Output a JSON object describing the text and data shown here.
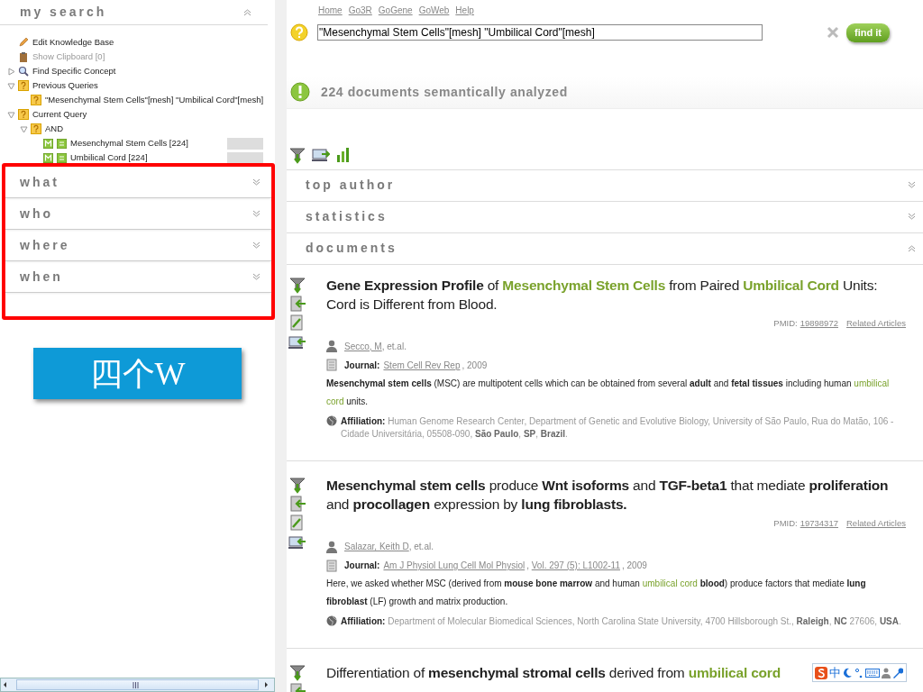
{
  "sidebar": {
    "title": "my search",
    "expanded": true,
    "tree": [
      {
        "kind": "edit",
        "label": "Edit Knowledge Base",
        "disabled": false
      },
      {
        "kind": "clipboard",
        "label": "Show Clipboard [0]",
        "disabled": true
      },
      {
        "kind": "search",
        "label": "Find Specific Concept",
        "disabled": false,
        "expanded": false
      },
      {
        "kind": "query",
        "label": "Previous Queries",
        "disabled": false,
        "expanded": true,
        "children": [
          {
            "kind": "query",
            "label": "\"Mesenchymal Stem Cells\"[mesh] \"Umbilical Cord\"[mesh]",
            "disabled": false
          }
        ]
      },
      {
        "kind": "query",
        "label": "Current Query",
        "disabled": false,
        "expanded": true,
        "children": [
          {
            "kind": "query",
            "label": "AND",
            "disabled": false,
            "expanded": true,
            "children": [
              {
                "kind": "concept",
                "label": "Mesenchymal Stem Cells [224]",
                "disabled": false
              },
              {
                "kind": "concept",
                "label": "Umbilical Cord [224]",
                "disabled": false
              }
            ]
          }
        ]
      }
    ],
    "sections_highlighted": true,
    "sections": [
      {
        "label": "what",
        "expanded": false
      },
      {
        "label": "who",
        "expanded": false
      },
      {
        "label": "where",
        "expanded": false
      },
      {
        "label": "when",
        "expanded": false
      }
    ],
    "callout": "四个W"
  },
  "nav": [
    "Home",
    "Go3R",
    "GoGene",
    "GoWeb",
    "Help"
  ],
  "query": {
    "value": "\"Mesenchymal Stem Cells\"[mesh] \"Umbilical Cord\"[mesh]"
  },
  "find_button": "find it",
  "status": "224 documents semantically analyzed",
  "panels": [
    {
      "label": "top author",
      "expanded": false
    },
    {
      "label": "statistics",
      "expanded": false
    },
    {
      "label": "documents",
      "expanded": true
    }
  ],
  "documents": [
    {
      "title": "**Gene Expression Profile** of *Mesenchymal Stem Cells* from Paired *Umbilical Cord* Units: Cord is Different from Blood.",
      "pmid_label": "PMID:",
      "pmid": "19898972",
      "related": "Related Articles",
      "author": "Secco, M",
      "author_suffix": ", et.al.",
      "journal_label": "Journal:",
      "journal": [
        {
          "kind": "link",
          "text": "Stem Cell Rev Rep"
        },
        {
          "kind": "text",
          "text": ", 2009"
        }
      ],
      "abstract": "**Mesenchymal stem cells** (MSC) are multipotent cells which can be obtained from several **adult** and **fetal tissues** including human *umbilical cord* units.",
      "affiliation_label": "Affiliation:",
      "affiliation": "Human Genome Research Center, Department of Genetic and Evolutive Biology, University of São Paulo, Rua do Matão, 106 - Cidade Universitária, 05508-090, **São Paulo**, **SP**, **Brazil**."
    },
    {
      "title": "**Mesenchymal stem cells** produce **Wnt isoforms** and **TGF-beta1** that mediate **proliferation** and **procollagen** expression by **lung fibroblasts.**",
      "pmid_label": "PMID:",
      "pmid": "19734317",
      "related": "Related Articles",
      "author": "Salazar, Keith D",
      "author_suffix": ", et.al.",
      "journal_label": "Journal:",
      "journal": [
        {
          "kind": "link",
          "text": "Am J Physiol Lung Cell Mol Physiol"
        },
        {
          "kind": "text",
          "text": ", "
        },
        {
          "kind": "link",
          "text": "Vol. 297 (5): L1002-11"
        },
        {
          "kind": "text",
          "text": ", 2009"
        }
      ],
      "abstract": "Here, we asked whether MSC (derived from **mouse bone marrow** and human *umbilical cord* **blood**) produce factors that mediate **lung fibroblast** (LF) growth and matrix production.",
      "affiliation_label": "Affiliation:",
      "affiliation": "Department of Molecular Biomedical Sciences, North Carolina State University, 4700 Hillsborough St., **Raleigh**, **NC** 27606, **USA**."
    },
    {
      "title": "Differentiation of **mesenchymal stromal cells** derived from *umbilical cord*"
    }
  ],
  "ime_toolbar": {
    "label": "中"
  }
}
